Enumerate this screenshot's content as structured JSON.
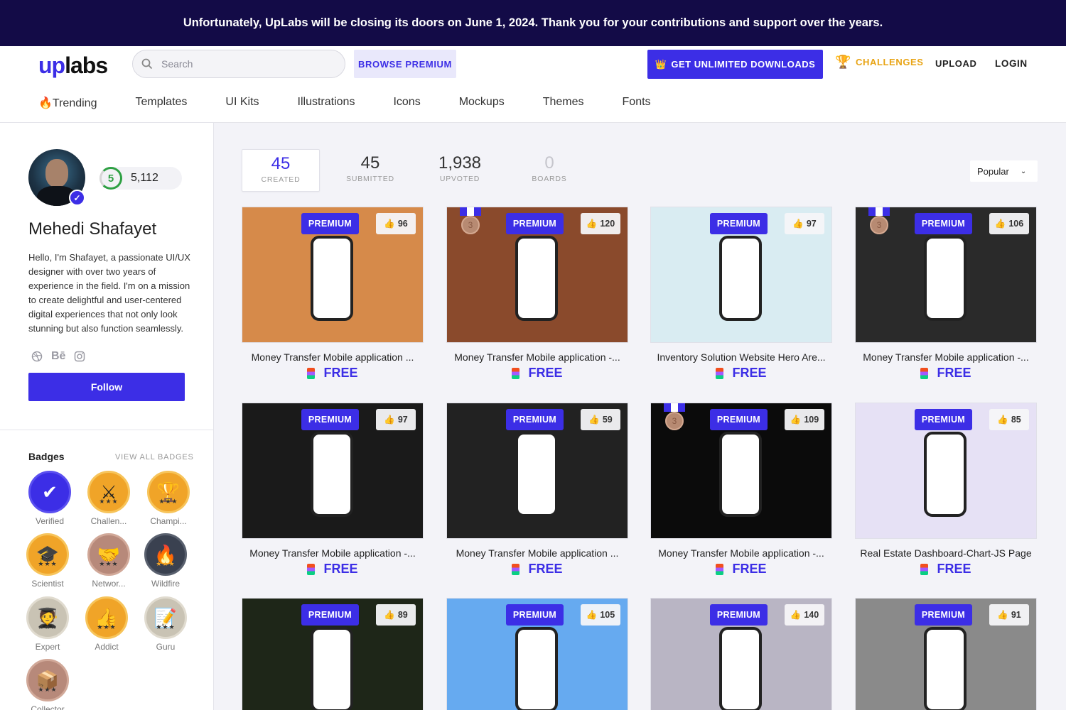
{
  "banner": "Unfortunately, UpLabs will be closing its doors on June 1, 2024. Thank you for your contributions and support over the years.",
  "header": {
    "logo_up": "up",
    "logo_labs": "labs",
    "search_placeholder": "Search",
    "browse_premium": "BROWSE PREMIUM",
    "unlimited": "GET UNLIMITED DOWNLOADS",
    "challenges": "CHALLENGES",
    "upload": "UPLOAD",
    "login": "LOGIN",
    "categories": [
      "🔥Trending",
      "Templates",
      "UI Kits",
      "Illustrations",
      "Icons",
      "Mockups",
      "Themes",
      "Fonts"
    ]
  },
  "profile": {
    "level": "5",
    "points": "5,112",
    "name": "Mehedi Shafayet",
    "bio": "Hello, I'm Shafayet, a passionate UI/UX designer with over two years of experience in the field. I'm on a mission to create delightful and user-centered digital experiences that not only look stunning but also function seamlessly.",
    "behance": "Bē",
    "follow": "Follow",
    "badges_title": "Badges",
    "view_all": "VIEW ALL BADGES",
    "badges": [
      {
        "label": "Verified",
        "icon": "check-icon",
        "color": "#3c2ee6",
        "stars": ""
      },
      {
        "label": "Challen...",
        "icon": "sword-icon",
        "color": "#f0a428",
        "stars": "★★★"
      },
      {
        "label": "Champi...",
        "icon": "trophy-icon",
        "color": "#f0a428",
        "stars": "★★★"
      },
      {
        "label": "Scientist",
        "icon": "grad-cap-icon",
        "color": "#f0a428",
        "stars": "★★★"
      },
      {
        "label": "Networ...",
        "icon": "handshake-icon",
        "color": "#b7897a",
        "stars": "★★★"
      },
      {
        "label": "Wildfire",
        "icon": "fire-icon",
        "color": "#3a4150",
        "stars": "★★★"
      },
      {
        "label": "Expert",
        "icon": "expert-icon",
        "color": "#c9c3b4",
        "stars": "★★★"
      },
      {
        "label": "Addict",
        "icon": "thumbs-up-icon",
        "color": "#f0a428",
        "stars": "★★★"
      },
      {
        "label": "Guru",
        "icon": "notepad-icon",
        "color": "#c9c3b4",
        "stars": "★★★"
      },
      {
        "label": "Collector",
        "icon": "box-icon",
        "color": "#b7897a",
        "stars": "★★★"
      }
    ]
  },
  "stats": [
    {
      "num": "45",
      "cap": "CREATED"
    },
    {
      "num": "45",
      "cap": "SUBMITTED"
    },
    {
      "num": "1,938",
      "cap": "UPVOTED"
    },
    {
      "num": "0",
      "cap": "BOARDS"
    }
  ],
  "sort": "Popular",
  "cards": [
    {
      "title": "Money Transfer Mobile application ...",
      "likes": "96",
      "medal": false,
      "bg": "#d68a4a"
    },
    {
      "title": "Money Transfer Mobile application -...",
      "likes": "120",
      "medal": true,
      "bg": "#8a4a2c"
    },
    {
      "title": "Inventory Solution Website Hero Are...",
      "likes": "97",
      "medal": false,
      "bg": "#d9ecf2"
    },
    {
      "title": "Money Transfer Mobile application -...",
      "likes": "106",
      "medal": true,
      "bg": "#2a2a2a"
    },
    {
      "title": "Money Transfer Mobile application -...",
      "likes": "97",
      "medal": false,
      "bg": "#1a1a1a"
    },
    {
      "title": "Money Transfer Mobile application ...",
      "likes": "59",
      "medal": false,
      "bg": "#222"
    },
    {
      "title": "Money Transfer Mobile application -...",
      "likes": "109",
      "medal": true,
      "bg": "#0b0b0b"
    },
    {
      "title": "Real Estate Dashboard-Chart-JS Page",
      "likes": "85",
      "medal": false,
      "bg": "#e6e1f5"
    },
    {
      "title": "",
      "likes": "89",
      "medal": false,
      "bg": "#1e2618"
    },
    {
      "title": "",
      "likes": "105",
      "medal": false,
      "bg": "#66aaf0"
    },
    {
      "title": "",
      "likes": "140",
      "medal": false,
      "bg": "#b9b5c4"
    },
    {
      "title": "",
      "likes": "91",
      "medal": false,
      "bg": "#8a8a8a"
    }
  ],
  "premium_label": "PREMIUM",
  "free_label": "FREE",
  "medal_num": "3"
}
